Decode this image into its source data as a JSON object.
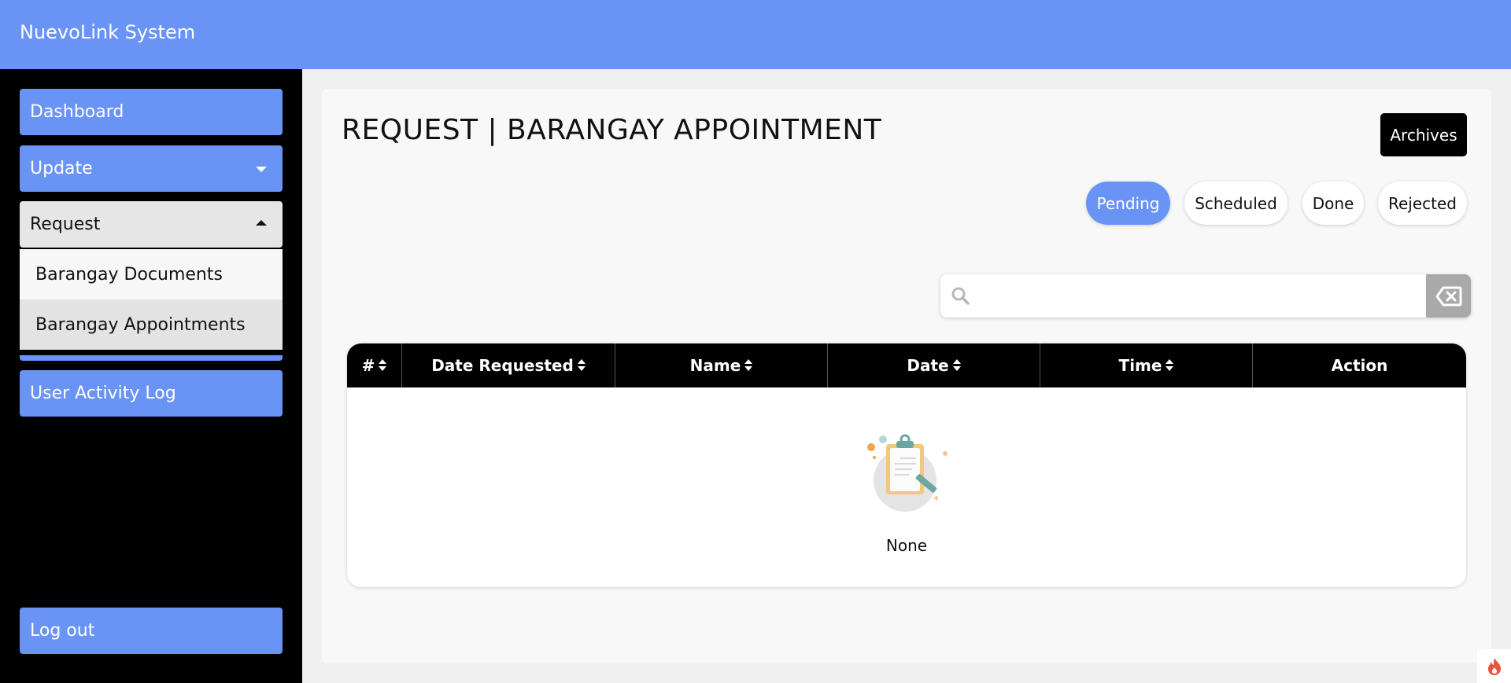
{
  "header": {
    "title": "NuevoLink System"
  },
  "sidebar": {
    "items": [
      {
        "label": "Dashboard"
      },
      {
        "label": "Update"
      },
      {
        "label": "Request"
      },
      {
        "label": "User Activity Log"
      }
    ],
    "request_submenu": [
      {
        "label": "Barangay Documents"
      },
      {
        "label": "Barangay Appointments"
      }
    ],
    "logout_label": "Log out"
  },
  "main": {
    "title": "REQUEST | BARANGAY APPOINTMENT",
    "archives_label": "Archives",
    "tabs": [
      {
        "label": "Pending",
        "active": true
      },
      {
        "label": "Scheduled"
      },
      {
        "label": "Done"
      },
      {
        "label": "Rejected"
      }
    ],
    "search": {
      "value": "",
      "placeholder": ""
    },
    "table": {
      "columns": [
        "#",
        "Date Requested",
        "Name",
        "Date",
        "Time",
        "Action"
      ],
      "rows": [],
      "empty_text": "None"
    }
  },
  "colors": {
    "accent": "#6994f6",
    "sidebar_bg": "#000000",
    "header_bg": "#000000"
  }
}
